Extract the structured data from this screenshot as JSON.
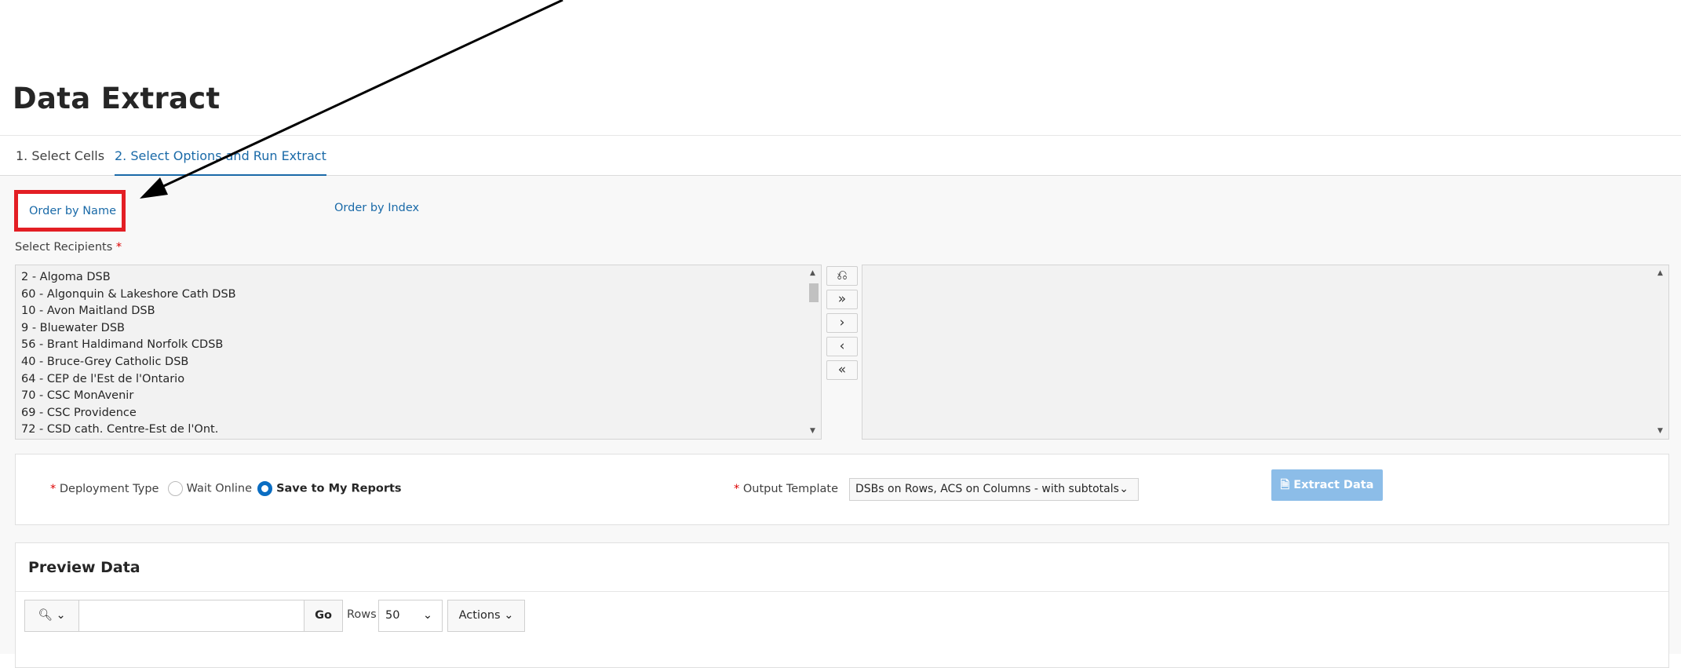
{
  "header": {
    "title": "Data Extract"
  },
  "tabs": [
    {
      "label": "1. Select Cells"
    },
    {
      "label": "2. Select Options and Run Extract",
      "active": true
    }
  ],
  "order": {
    "by_name": "Order by Name",
    "by_index": "Order by Index"
  },
  "recipients": {
    "label": "Select Recipients",
    "required": "*",
    "available": [
      "2 - Algoma DSB",
      "60 - Algonquin & Lakeshore Cath DSB",
      "10 - Avon Maitland DSB",
      "9 - Bluewater DSB",
      "56 - Brant Haldimand Norfolk CDSB",
      "40 - Bruce-Grey Catholic DSB",
      "64 - CEP de l'Est de l'Ontario",
      "70 - CSC MonAvenir",
      "69 - CSC Providence",
      "72 - CSD cath. Centre-Est de l'Ont."
    ],
    "selected": [],
    "shuttle_icons": [
      "reset-icon",
      "move-all-icon",
      "move-icon",
      "remove-icon",
      "remove-all-icon"
    ]
  },
  "options": {
    "deployment_label": "Deployment Type",
    "radio_wait": "Wait Online",
    "radio_save": "Save to My Reports",
    "selected_deployment": "Save to My Reports",
    "output_label": "Output Template",
    "output_value": "DSBs on Rows, ACS on Columns - with subtotals",
    "extract_label": "Extract Data"
  },
  "preview": {
    "title": "Preview Data",
    "search_value": "",
    "go_label": "Go",
    "rows_label": "Rows",
    "rows_value": "50",
    "actions_label": "Actions"
  },
  "colors": {
    "accent": "#1a6aa8",
    "highlight": "#e31e24",
    "button": "#8cbde8"
  }
}
